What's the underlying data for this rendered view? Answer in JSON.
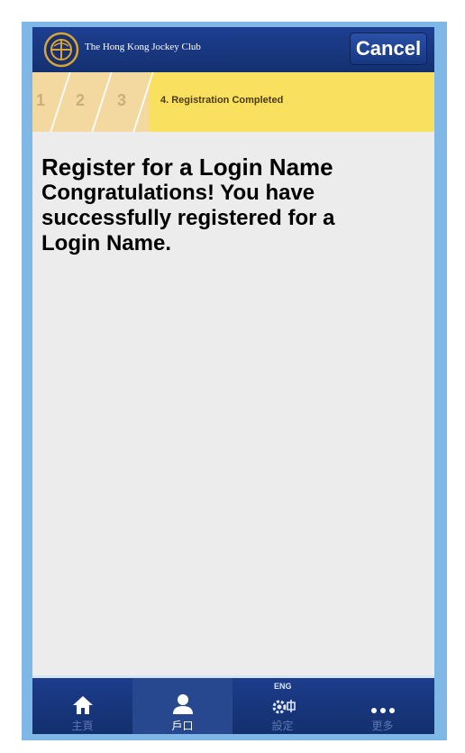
{
  "header": {
    "club_name": "The Hong Kong Jockey Club",
    "cancel_label": "Cancel"
  },
  "steps": {
    "items": [
      "1",
      "2",
      "3"
    ],
    "active_label": "4. Registration Completed"
  },
  "content": {
    "title": "Register for a Login Name",
    "message": "Congratulations! You have successfully registered for a Login Name."
  },
  "bottom_nav": {
    "items": [
      {
        "label": "主頁",
        "icon": "home-icon"
      },
      {
        "label": "戶口",
        "icon": "account-icon"
      },
      {
        "label": "設定",
        "icon": "settings-icon"
      },
      {
        "label": "更多",
        "icon": "more-icon"
      }
    ],
    "language_toggle": "ENG"
  },
  "colors": {
    "header_blue": "#13306f",
    "step_yellow": "#f9e05e",
    "frame_blue": "#7fb8e6"
  }
}
